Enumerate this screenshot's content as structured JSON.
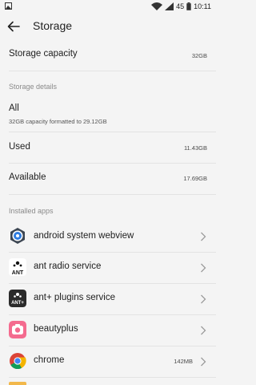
{
  "status_bar": {
    "signal_text": "45",
    "time": "10:11"
  },
  "app_bar": {
    "title": "Storage"
  },
  "storage_capacity": {
    "label": "Storage capacity",
    "value": "32GB"
  },
  "details_section": {
    "header": "Storage details",
    "all": {
      "label": "All",
      "subtitle": "32GB capacity formatted to 29.12GB"
    },
    "used": {
      "label": "Used",
      "value": "11.43GB"
    },
    "available": {
      "label": "Available",
      "value": "17.69GB"
    }
  },
  "installed_section": {
    "header": "Installed apps",
    "apps": [
      {
        "name": "android system webview",
        "size": "",
        "icon": "android-webview-icon"
      },
      {
        "name": "ant radio service",
        "size": "",
        "icon": "ant-radio-icon"
      },
      {
        "name": "ant+ plugins service",
        "size": "",
        "icon": "ant-plus-icon"
      },
      {
        "name": "beautyplus",
        "size": "",
        "icon": "beautyplus-icon"
      },
      {
        "name": "chrome",
        "size": "142MB",
        "icon": "chrome-icon"
      }
    ]
  },
  "colors": {
    "background": "#f4f4f4",
    "divider": "#e3e3e3",
    "section_text": "#8a8a8a"
  }
}
